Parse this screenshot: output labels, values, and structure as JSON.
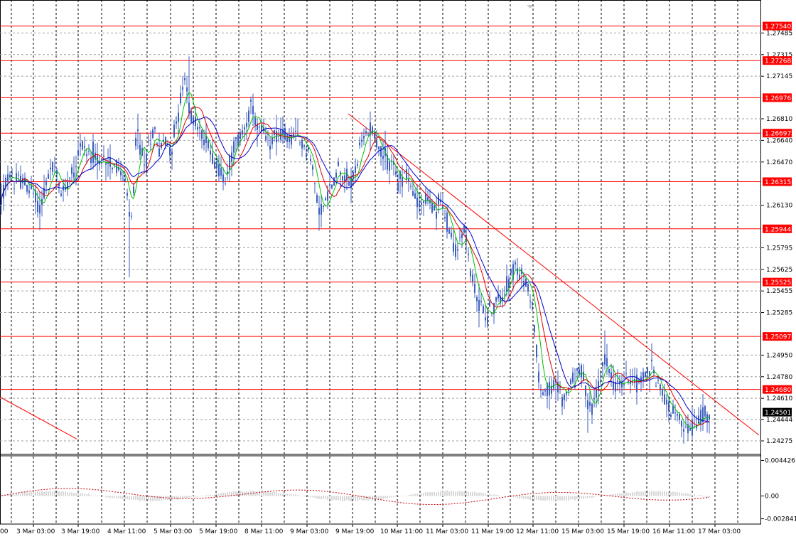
{
  "chart_data": {
    "type": "candlestick",
    "grid": true,
    "price_scale": {
      "ylim": [
        1.2418,
        1.277
      ]
    },
    "y_ticks": [
      "1.27485",
      "1.27315",
      "1.27145",
      "1.26810",
      "1.26640",
      "1.26470",
      "1.26130",
      "1.25795",
      "1.25625",
      "1.25455",
      "1.25285",
      "1.24950",
      "1.24780",
      "1.24610",
      "1.24444",
      "1.24275"
    ],
    "x_ticks": [
      "3 Mar 03:00",
      "3 Mar 19:00",
      "4 Mar 11:00",
      "5 Mar 03:00",
      "5 Mar 19:00",
      "8 Mar 11:00",
      "9 Mar 03:00",
      "9 Mar 19:00",
      "10 Mar 11:00",
      "11 Mar 03:00",
      "11 Mar 19:00",
      "12 Mar 11:00",
      "15 Mar 03:00",
      "15 Mar 19:00",
      "16 Mar 11:00",
      "17 Mar 03:00"
    ],
    "x_tick_first_partial": "00",
    "levels": [
      {
        "value": 1.2754,
        "label": "1.27540"
      },
      {
        "value": 1.27268,
        "label": "1.27268"
      },
      {
        "value": 1.26976,
        "label": "1.26976"
      },
      {
        "value": 1.26697,
        "label": "1.26697"
      },
      {
        "value": 1.26315,
        "label": "1.26315"
      },
      {
        "value": 1.25944,
        "label": "1.25944"
      },
      {
        "value": 1.25525,
        "label": "1.25525"
      },
      {
        "value": 1.25097,
        "label": "1.25097"
      },
      {
        "value": 1.2468,
        "label": "1.24680"
      }
    ],
    "current_price": {
      "value": 1.24501,
      "label": "1.24501"
    },
    "price_path": [
      [
        0,
        1.2612
      ],
      [
        8,
        1.263
      ],
      [
        12,
        1.2636
      ],
      [
        20,
        1.2632
      ],
      [
        30,
        1.2633
      ],
      [
        40,
        1.2626
      ],
      [
        48,
        1.2622
      ],
      [
        56,
        1.261
      ],
      [
        62,
        1.2624
      ],
      [
        70,
        1.2638
      ],
      [
        76,
        1.2644
      ],
      [
        82,
        1.263
      ],
      [
        88,
        1.262
      ],
      [
        96,
        1.2636
      ],
      [
        104,
        1.2642
      ],
      [
        112,
        1.2658
      ],
      [
        118,
        1.2662
      ],
      [
        124,
        1.265
      ],
      [
        130,
        1.2656
      ],
      [
        136,
        1.2648
      ],
      [
        142,
        1.2642
      ],
      [
        148,
        1.2652
      ],
      [
        154,
        1.2648
      ],
      [
        160,
        1.2646
      ],
      [
        168,
        1.264
      ],
      [
        176,
        1.263
      ],
      [
        180,
        1.2615
      ],
      [
        184,
        1.2594
      ],
      [
        188,
        1.2625
      ],
      [
        192,
        1.2675
      ],
      [
        196,
        1.266
      ],
      [
        200,
        1.2652
      ],
      [
        206,
        1.2648
      ],
      [
        212,
        1.2668
      ],
      [
        218,
        1.2672
      ],
      [
        224,
        1.2658
      ],
      [
        228,
        1.266
      ],
      [
        234,
        1.2664
      ],
      [
        240,
        1.2654
      ],
      [
        246,
        1.2672
      ],
      [
        252,
        1.2688
      ],
      [
        258,
        1.271
      ],
      [
        262,
        1.2705
      ],
      [
        266,
        1.2692
      ],
      [
        270,
        1.268
      ],
      [
        276,
        1.2678
      ],
      [
        282,
        1.267
      ],
      [
        288,
        1.2664
      ],
      [
        294,
        1.266
      ],
      [
        300,
        1.2652
      ],
      [
        306,
        1.2642
      ],
      [
        312,
        1.2638
      ],
      [
        318,
        1.263
      ],
      [
        324,
        1.265
      ],
      [
        330,
        1.266
      ],
      [
        336,
        1.2664
      ],
      [
        342,
        1.2672
      ],
      [
        348,
        1.2682
      ],
      [
        354,
        1.269
      ],
      [
        358,
        1.268
      ],
      [
        364,
        1.2672
      ],
      [
        370,
        1.2668
      ],
      [
        378,
        1.2662
      ],
      [
        386,
        1.2668
      ],
      [
        392,
        1.267
      ],
      [
        398,
        1.2668
      ],
      [
        406,
        1.2665
      ],
      [
        412,
        1.2666
      ],
      [
        420,
        1.2664
      ],
      [
        428,
        1.266
      ],
      [
        434,
        1.2656
      ],
      [
        440,
        1.264
      ],
      [
        446,
        1.2618
      ],
      [
        452,
        1.261
      ],
      [
        458,
        1.2614
      ],
      [
        464,
        1.2626
      ],
      [
        470,
        1.2632
      ],
      [
        476,
        1.2644
      ],
      [
        482,
        1.264
      ],
      [
        488,
        1.2634
      ],
      [
        494,
        1.263
      ],
      [
        500,
        1.2642
      ],
      [
        506,
        1.2655
      ],
      [
        512,
        1.2666
      ],
      [
        518,
        1.2672
      ],
      [
        524,
        1.2676
      ],
      [
        530,
        1.2662
      ],
      [
        536,
        1.2656
      ],
      [
        542,
        1.265
      ],
      [
        548,
        1.2646
      ],
      [
        554,
        1.2648
      ],
      [
        558,
        1.2628
      ],
      [
        564,
        1.2632
      ],
      [
        570,
        1.264
      ],
      [
        576,
        1.263
      ],
      [
        582,
        1.262
      ],
      [
        588,
        1.2618
      ],
      [
        594,
        1.2614
      ],
      [
        600,
        1.2618
      ],
      [
        606,
        1.2612
      ],
      [
        612,
        1.2608
      ],
      [
        618,
        1.2616
      ],
      [
        624,
        1.261
      ],
      [
        630,
        1.2598
      ],
      [
        636,
        1.2585
      ],
      [
        642,
        1.2578
      ],
      [
        648,
        1.2584
      ],
      [
        654,
        1.2595
      ],
      [
        660,
        1.257
      ],
      [
        666,
        1.2548
      ],
      [
        672,
        1.254
      ],
      [
        678,
        1.2532
      ],
      [
        684,
        1.2526
      ],
      [
        690,
        1.253
      ],
      [
        696,
        1.2534
      ],
      [
        702,
        1.2538
      ],
      [
        708,
        1.2546
      ],
      [
        714,
        1.2552
      ],
      [
        720,
        1.256
      ],
      [
        726,
        1.2562
      ],
      [
        732,
        1.2558
      ],
      [
        738,
        1.2552
      ],
      [
        744,
        1.2548
      ],
      [
        750,
        1.253
      ],
      [
        754,
        1.2505
      ],
      [
        758,
        1.2478
      ],
      [
        762,
        1.2465
      ],
      [
        768,
        1.2468
      ],
      [
        774,
        1.2468
      ],
      [
        780,
        1.247
      ],
      [
        786,
        1.2468
      ],
      [
        792,
        1.246
      ],
      [
        798,
        1.2466
      ],
      [
        804,
        1.2472
      ],
      [
        810,
        1.2478
      ],
      [
        816,
        1.2484
      ],
      [
        822,
        1.2475
      ],
      [
        828,
        1.245
      ],
      [
        834,
        1.2455
      ],
      [
        840,
        1.2465
      ],
      [
        846,
        1.248
      ],
      [
        850,
        1.249
      ],
      [
        856,
        1.2488
      ],
      [
        862,
        1.2475
      ],
      [
        868,
        1.247
      ],
      [
        874,
        1.2472
      ],
      [
        880,
        1.2475
      ],
      [
        886,
        1.2478
      ],
      [
        892,
        1.2476
      ],
      [
        898,
        1.2474
      ],
      [
        904,
        1.2476
      ],
      [
        910,
        1.248
      ],
      [
        916,
        1.2488
      ],
      [
        922,
        1.2478
      ],
      [
        928,
        1.247
      ],
      [
        934,
        1.2462
      ],
      [
        940,
        1.2458
      ],
      [
        946,
        1.2452
      ],
      [
        952,
        1.2446
      ],
      [
        958,
        1.244
      ],
      [
        964,
        1.2436
      ],
      [
        970,
        1.2438
      ],
      [
        976,
        1.244
      ],
      [
        982,
        1.2444
      ],
      [
        988,
        1.2448
      ],
      [
        994,
        1.2452
      ],
      [
        1000,
        1.245
      ]
    ],
    "trendlines": [
      {
        "x1": 490,
        "y1": 1.2685,
        "x2": 1068,
        "y2": 1.2432
      },
      {
        "x1": 0,
        "y1": 1.2462,
        "x2": 108,
        "y2": 1.2429
      }
    ],
    "colors": {
      "candles": "#3c5fbf",
      "ma_fast": "#00c000",
      "ma_mid": "#dd0000",
      "ma_slow": "#0000cc",
      "levels": "#ff0000",
      "trendline": "#ff0000",
      "label_bg": "#ff0000",
      "current_bg": "#000000",
      "grid": "#a0a0a0",
      "vgrid": "#000000"
    },
    "oscillator": {
      "ticks": [
        "0.004426",
        "0.00",
        "-0.002841"
      ],
      "ylim": [
        -0.0035,
        0.005
      ],
      "zero": 0.0,
      "color": "#c00000",
      "hist_color": "#b0b0b0"
    }
  }
}
